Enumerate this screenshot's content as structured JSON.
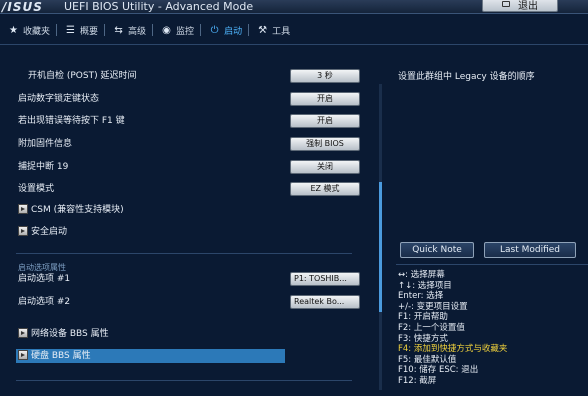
{
  "header": {
    "logo": "/ISUS",
    "title": "UEFI BIOS Utility - Advanced Mode",
    "exit_label": "退出"
  },
  "menu": [
    {
      "icon": "star-icon",
      "glyph": "★",
      "label": "收藏夹"
    },
    {
      "icon": "list-icon",
      "glyph": "☰",
      "label": "概要"
    },
    {
      "icon": "advanced-icon",
      "glyph": "⇆",
      "label": "高级"
    },
    {
      "icon": "monitor-icon",
      "glyph": "◉",
      "label": "监控"
    },
    {
      "icon": "power-icon",
      "glyph": "⏻",
      "label": "启动",
      "active": true
    },
    {
      "icon": "tool-icon",
      "glyph": "⚒",
      "label": "工具"
    }
  ],
  "settings": [
    {
      "label": "开机自检 (POST) 延迟时间",
      "value": "3 秒"
    },
    {
      "label": "启动数字锁定键状态",
      "value": "开启"
    },
    {
      "label": "若出现错误等待按下 F1 键",
      "value": "开启"
    },
    {
      "label": "附加固件信息",
      "value": "强制 BIOS"
    },
    {
      "label": "捕捉中断 19",
      "value": "关闭"
    },
    {
      "label": "设置模式",
      "value": "EZ 模式"
    }
  ],
  "submenus": {
    "csm": "CSM (兼容性支持模块)",
    "secure_boot": "安全启动",
    "network_bbs": "网络设备 BBS 属性",
    "hdd_bbs": "硬盘 BBS 属性"
  },
  "boot_options": {
    "section_title": "启动选项属性",
    "items": [
      {
        "label": "启动选项 #1",
        "value": "P1: TOSHIB..."
      },
      {
        "label": "启动选项 #2",
        "value": "Realtek Bo..."
      }
    ]
  },
  "help": {
    "text": "设置此群组中 Legacy 设备的顺序",
    "quick_note": "Quick Note",
    "last_modified": "Last Modified"
  },
  "keys": [
    {
      "text": "↔: 选择屏幕"
    },
    {
      "text": "↑↓: 选择项目"
    },
    {
      "text": "Enter: 选择"
    },
    {
      "text": "+/-: 变更项目设置"
    },
    {
      "text": "F1: 开启帮助"
    },
    {
      "text": "F2: 上一个设置值"
    },
    {
      "text": "F3: 快捷方式"
    },
    {
      "text": "F4: 添加到快捷方式与收藏夹",
      "highlight": true
    },
    {
      "text": "F5: 最佳默认值"
    },
    {
      "text": "F10: 储存  ESC: 退出"
    },
    {
      "text": "F12: 截屏"
    }
  ],
  "colors": {
    "background": "#0a1a33",
    "accent": "#4fb6ff",
    "highlight_row": "#2c79b8",
    "key_highlight": "#f1d23c"
  }
}
